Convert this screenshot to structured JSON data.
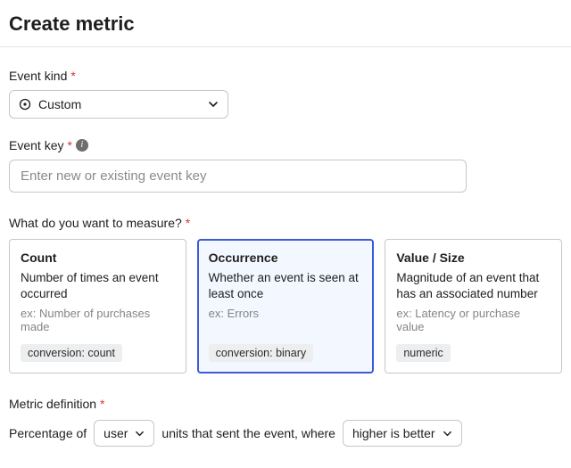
{
  "page": {
    "title": "Create metric"
  },
  "event_kind": {
    "label": "Event kind",
    "value": "Custom"
  },
  "event_key": {
    "label": "Event key",
    "placeholder": "Enter new or existing event key"
  },
  "measure": {
    "label": "What do you want to measure?",
    "options": [
      {
        "title": "Count",
        "desc": "Number of times an event occurred",
        "example": "ex: Number of purchases made",
        "tag": "conversion: count",
        "selected": false
      },
      {
        "title": "Occurrence",
        "desc": "Whether an event is seen at least once",
        "example": "ex: Errors",
        "tag": "conversion: binary",
        "selected": true
      },
      {
        "title": "Value / Size",
        "desc": "Magnitude of an event that has an associated number",
        "example": "ex: Latency or purchase value",
        "tag": "numeric",
        "selected": false
      }
    ]
  },
  "definition": {
    "label": "Metric definition",
    "prefix": "Percentage of",
    "unit_value": "user",
    "middle": "units that sent the event, where",
    "direction_value": "higher is better"
  }
}
